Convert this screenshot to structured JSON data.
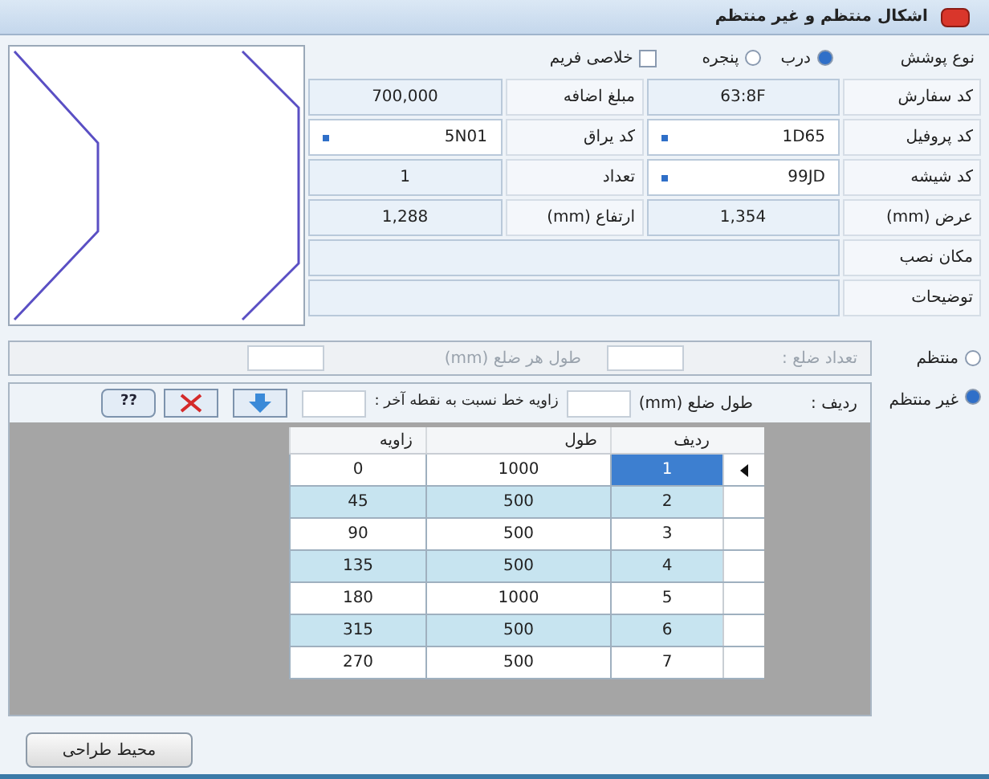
{
  "window": {
    "title": "اشکال منتظم و غیر منتظم"
  },
  "type_row": {
    "label": "نوع پوشش",
    "options": [
      {
        "label": "درب",
        "selected": true
      },
      {
        "label": "پنجره",
        "selected": false
      }
    ],
    "checkbox": {
      "label": "خلاصی فریم",
      "checked": false
    }
  },
  "field_rows": [
    [
      {
        "label": "کد سفارش",
        "value": "63:8F",
        "kind": "text"
      },
      {
        "label": "مبلغ اضافه",
        "value": "700,000",
        "kind": "text"
      }
    ],
    [
      {
        "label": "کد پروفیل",
        "value": "1D65",
        "kind": "combo"
      },
      {
        "label": "کد یراق",
        "value": "5N01",
        "kind": "combo"
      }
    ],
    [
      {
        "label": "کد شیشه",
        "value": "99JD",
        "kind": "combo"
      },
      {
        "label": "تعداد",
        "value": "1",
        "kind": "text"
      }
    ],
    [
      {
        "label": "عرض (mm)",
        "value": "1,354",
        "kind": "text"
      },
      {
        "label": "ارتفاع (mm)",
        "value": "1,288",
        "kind": "text"
      }
    ]
  ],
  "wide_fields": [
    {
      "label": "مکان نصب"
    },
    {
      "label": "توضیحات"
    }
  ],
  "shape_mode": [
    {
      "label": "منتظم",
      "selected": false
    },
    {
      "label": "غیر منتظم",
      "selected": true
    }
  ],
  "regular": {
    "sides_label": "تعداد ضلع :",
    "side_length_label": "طول هر ضلع (mm)",
    "disabled": true
  },
  "irregular": {
    "row_label": "ردیف :",
    "length_label": "طول ضلع (mm)",
    "angle_label": "زاویه خط نسبت به نقطه آخر :",
    "help_button": "??"
  },
  "table": {
    "columns": [
      "ردیف",
      "طول",
      "زاویه"
    ],
    "rows": [
      {
        "cells": [
          "1",
          "1000",
          "0"
        ],
        "selected": true,
        "current": true
      },
      {
        "cells": [
          "2",
          "500",
          "45"
        ],
        "selected": false,
        "current": false
      },
      {
        "cells": [
          "3",
          "500",
          "90"
        ],
        "selected": false,
        "current": false
      },
      {
        "cells": [
          "4",
          "500",
          "135"
        ],
        "selected": false,
        "current": false
      },
      {
        "cells": [
          "5",
          "1000",
          "180"
        ],
        "selected": false,
        "current": false
      },
      {
        "cells": [
          "6",
          "500",
          "315"
        ],
        "selected": false,
        "current": false
      },
      {
        "cells": [
          "7",
          "500",
          "270"
        ],
        "selected": false,
        "current": false
      }
    ]
  },
  "footer_button": "محیط طراحی"
}
